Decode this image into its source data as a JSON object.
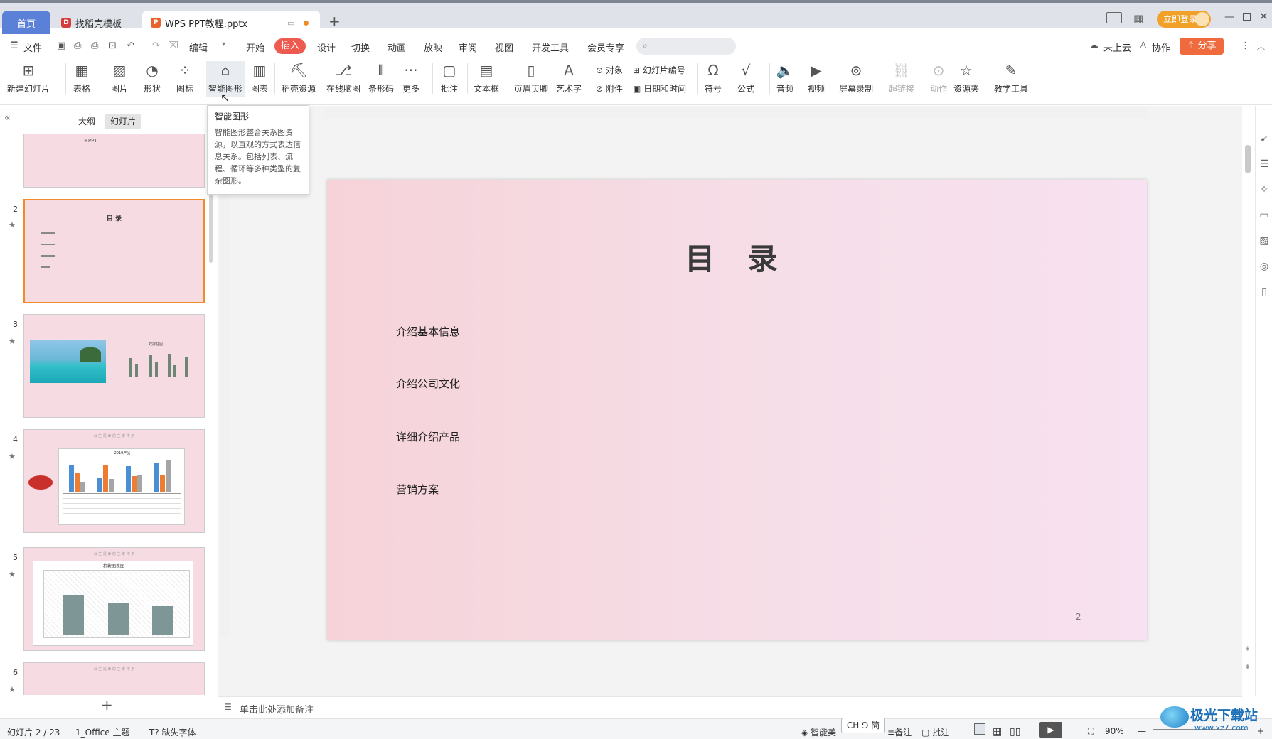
{
  "tabs": {
    "home": "首页",
    "template": "找稻壳模板",
    "active_file": "WPS PPT教程.pptx",
    "new_tab": "+"
  },
  "titlebar": {
    "login": "立即登录"
  },
  "menu": {
    "file": "文件",
    "edit": "编辑",
    "items": [
      "开始",
      "插入",
      "设计",
      "切换",
      "动画",
      "放映",
      "审阅",
      "视图",
      "开发工具",
      "会员专享"
    ],
    "cloud": "未上云",
    "collab": "协作",
    "share": "分享"
  },
  "ribbon": {
    "new_slide": "新建幻灯片",
    "table": "表格",
    "picture": "图片",
    "shape": "形状",
    "icon": "图标",
    "smartart": "智能图形",
    "chart": "图表",
    "docer": "稻壳资源",
    "mindmap": "在线脑图",
    "barcode": "条形码",
    "more": "更多",
    "comment": "批注",
    "textbox": "文本框",
    "header_footer": "页眉页脚",
    "wordart": "艺术字",
    "object": "对象",
    "attachment": "附件",
    "slide_number": "幻灯片编号",
    "datetime": "日期和时间",
    "symbol": "符号",
    "formula": "公式",
    "audio": "音频",
    "video": "视频",
    "screen_record": "屏幕录制",
    "hyperlink": "超链接",
    "action": "动作",
    "resources": "资源夹",
    "teaching": "教学工具"
  },
  "tooltip": {
    "title": "智能图形",
    "description": "智能图形整合关系图资源，以直观的方式表达信息关系。包括列表、流程、循环等多种类型的复杂图形。"
  },
  "left_panel": {
    "tab_outline": "大纲",
    "tab_slides": "幻灯片",
    "slide1_text": "+PPT",
    "slide2_title": "目 录",
    "slide3_title": "双排柱图",
    "slide4_header": "公 生 是 命 的 主 宰 作 用",
    "slide4_chart_title": "2019产品",
    "slide5_header": "公 生 是 命 的 主 宰 作 用",
    "slide5_chart_title": "柱状图表图",
    "slide6_header": "公 生 是 命 的 主 宰 作 用",
    "slide_numbers": [
      "2",
      "3",
      "4",
      "5",
      "6"
    ],
    "add": "+"
  },
  "slide": {
    "title": "目 录",
    "items": [
      "介绍基本信息",
      "介绍公司文化",
      "详细介绍产品",
      "营销方案"
    ],
    "page_number": "2"
  },
  "notes": {
    "placeholder": "单击此处添加备注"
  },
  "status": {
    "slide_count": "幻灯片 2 / 23",
    "theme": "1_Office 主题",
    "missing_font": "缺失字体",
    "smart_beautify": "智能美",
    "ime": "CH ⅁ 简",
    "notes": "备注",
    "comment": "批注",
    "zoom": "90%"
  },
  "watermark": {
    "text": "极光下载站",
    "url": "www.xz7.com"
  },
  "colors": {
    "accent": "#ee5a4f",
    "login": "#f2a128",
    "home_tab": "#5a80d8",
    "slide_bg": "#f6d8e2",
    "active_thumb": "#f08c28"
  }
}
